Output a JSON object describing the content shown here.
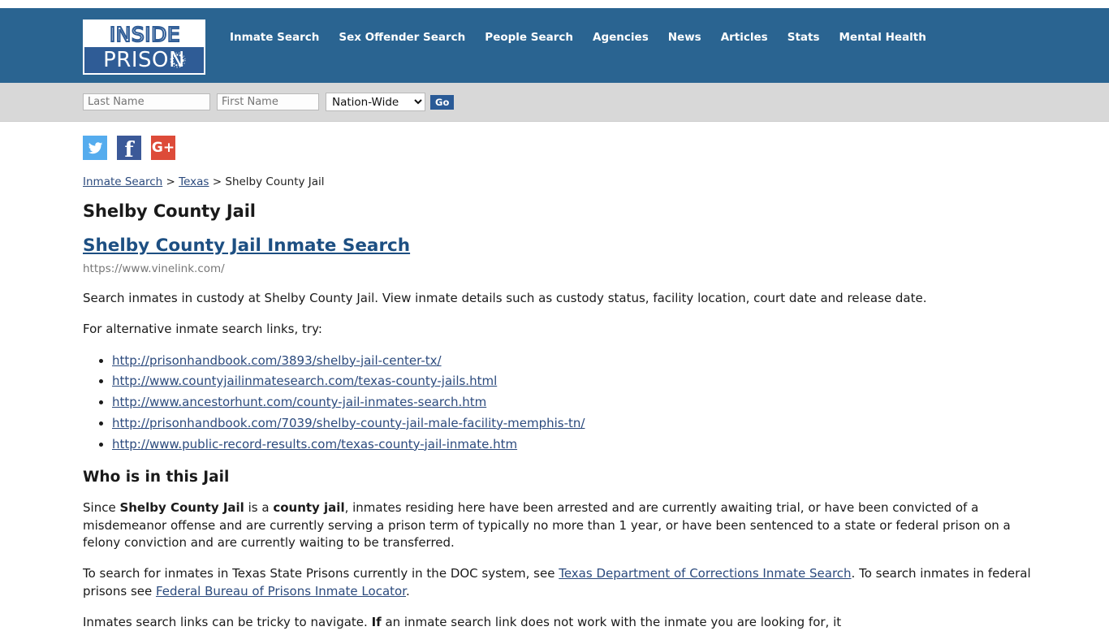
{
  "header": {
    "logo": {
      "line1": "INSIDE",
      "line2": "PRISON"
    },
    "nav": [
      {
        "label": "Inmate Search"
      },
      {
        "label": "Sex Offender Search"
      },
      {
        "label": "People Search"
      },
      {
        "label": "Agencies"
      },
      {
        "label": "News"
      },
      {
        "label": "Articles"
      },
      {
        "label": "Stats"
      },
      {
        "label": "Mental Health"
      }
    ],
    "background_color": "#2a6491"
  },
  "search": {
    "last_name_placeholder": "Last Name",
    "last_name_value": "",
    "first_name_placeholder": "First Name",
    "first_name_value": "",
    "region_selected": "Nation-Wide",
    "region_options": [
      "Nation-Wide"
    ],
    "go_label": "Go"
  },
  "social": [
    {
      "name": "twitter",
      "glyph": "🐦",
      "color": "#55acee"
    },
    {
      "name": "facebook",
      "glyph": "f",
      "color": "#3b5998"
    },
    {
      "name": "google-plus",
      "glyph": "G+",
      "color": "#dd4b39"
    }
  ],
  "breadcrumb": {
    "items": [
      {
        "label": "Inmate Search",
        "link": true
      },
      {
        "label": "Texas",
        "link": true
      },
      {
        "label": "Shelby County Jail",
        "link": false
      }
    ],
    "separator": ">"
  },
  "main": {
    "page_title": "Shelby County Jail",
    "primary_link_text": "Shelby County Jail Inmate Search",
    "primary_link_url": "https://www.vinelink.com/",
    "description": "Search inmates in custody at Shelby County Jail. View inmate details such as custody status, facility location, court date and release date.",
    "alt_links_intro": "For alternative inmate search links, try:",
    "alt_links": [
      "http://prisonhandbook.com/3893/shelby-jail-center-tx/",
      "http://www.countyjailinmatesearch.com/texas-county-jails.html",
      "http://www.ancestorhunt.com/county-jail-inmates-search.htm",
      "http://prisonhandbook.com/7039/shelby-county-jail-male-facility-memphis-tn/",
      "http://www.public-record-results.com/texas-county-jail-inmate.htm"
    ],
    "section_title": "Who is in this Jail",
    "who_para": {
      "part1": "Since ",
      "bold1": "Shelby County Jail",
      "part2": " is a ",
      "bold2": "county jail",
      "part3": ", inmates residing here have been arrested and are currently awaiting trial, or have been convicted of a misdemeanor offense and are currently serving a prison term of typically no more than 1 year, or have been sentenced to a state or federal prison on a felony conviction and are currently waiting to be transferred."
    },
    "doc_para": {
      "part1": "To search for inmates in Texas State Prisons currently in the DOC system, see ",
      "link1": "Texas Department of Corrections Inmate Search",
      "part2": ". To search inmates in federal prisons see ",
      "link2": "Federal Bureau of Prisons Inmate Locator",
      "part3": "."
    },
    "clipped_para": {
      "part1": "Inmates search links can be tricky to navigate. ",
      "bold1": "If",
      "part2": " an inmate search link does not work with the inmate you are looking for, it"
    }
  },
  "colors": {
    "header_blue": "#2a6491",
    "search_gray": "#d8d8d8",
    "link_blue": "#2b4a7d",
    "heading_dark": "#1a1a1a"
  }
}
